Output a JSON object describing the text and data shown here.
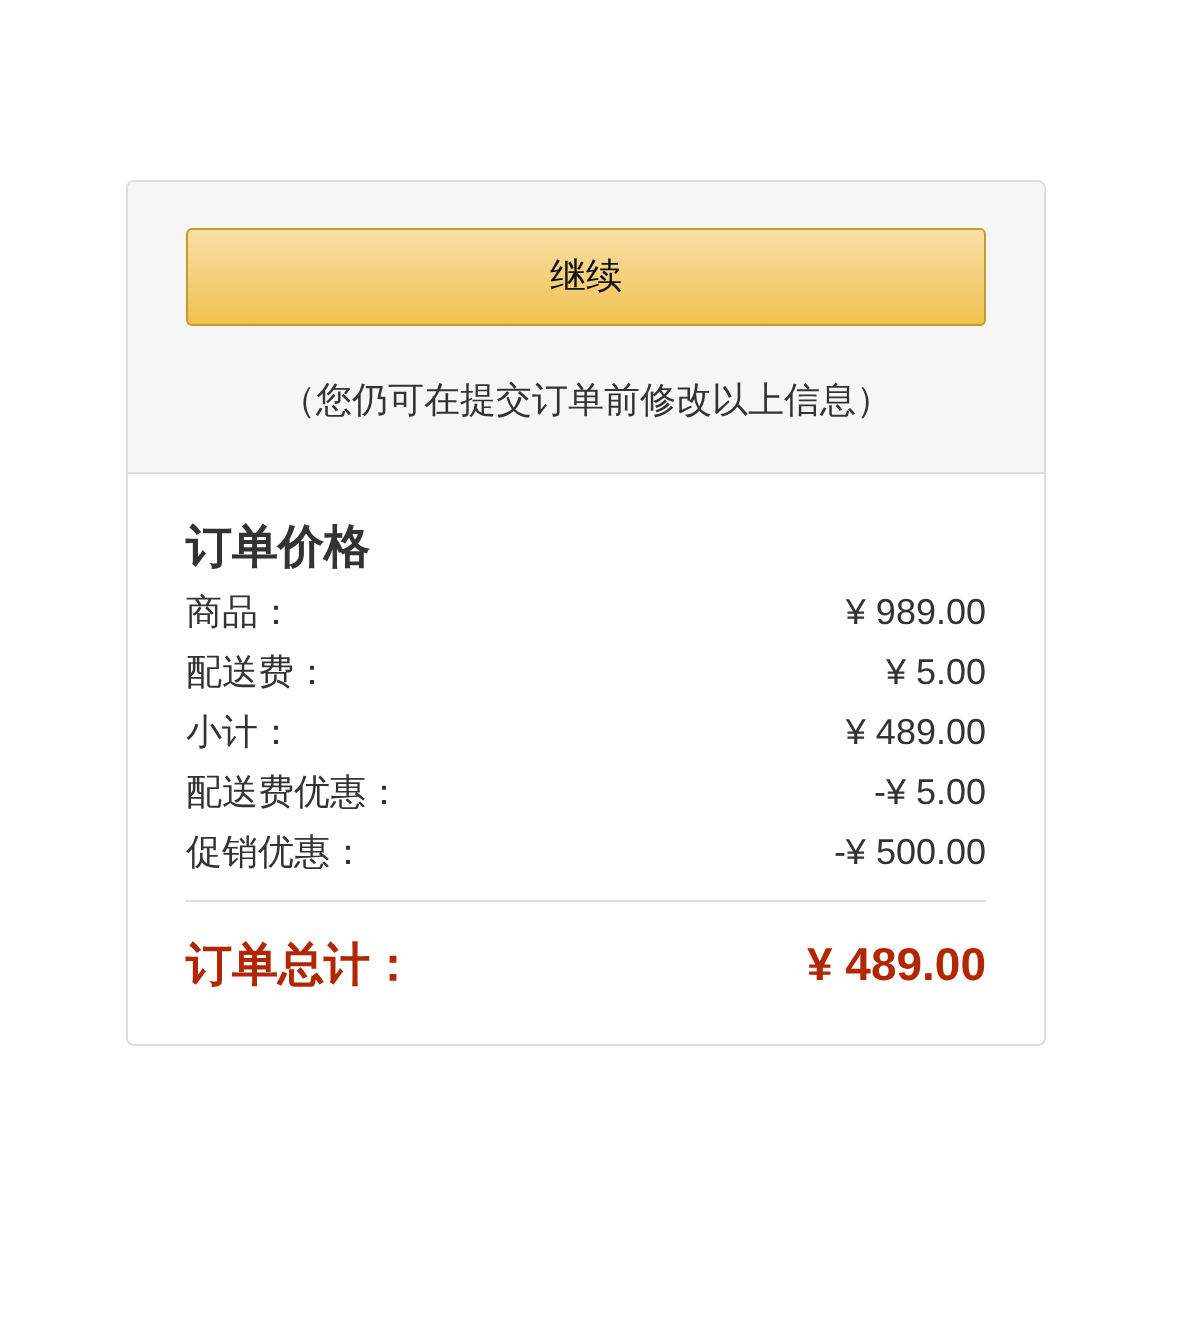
{
  "continue_button": {
    "label": "继续"
  },
  "note": "（您仍可在提交订单前修改以上信息）",
  "summary": {
    "title": "订单价格",
    "rows": [
      {
        "label": "商品：",
        "value": "¥ 989.00"
      },
      {
        "label": "配送费：",
        "value": "¥ 5.00"
      },
      {
        "label": "小计：",
        "value": "¥ 489.00"
      },
      {
        "label": "配送费优惠：",
        "value": "-¥ 5.00"
      },
      {
        "label": "促销优惠：",
        "value": "-¥ 500.00"
      }
    ],
    "total": {
      "label": "订单总计：",
      "value": "¥ 489.00"
    }
  }
}
